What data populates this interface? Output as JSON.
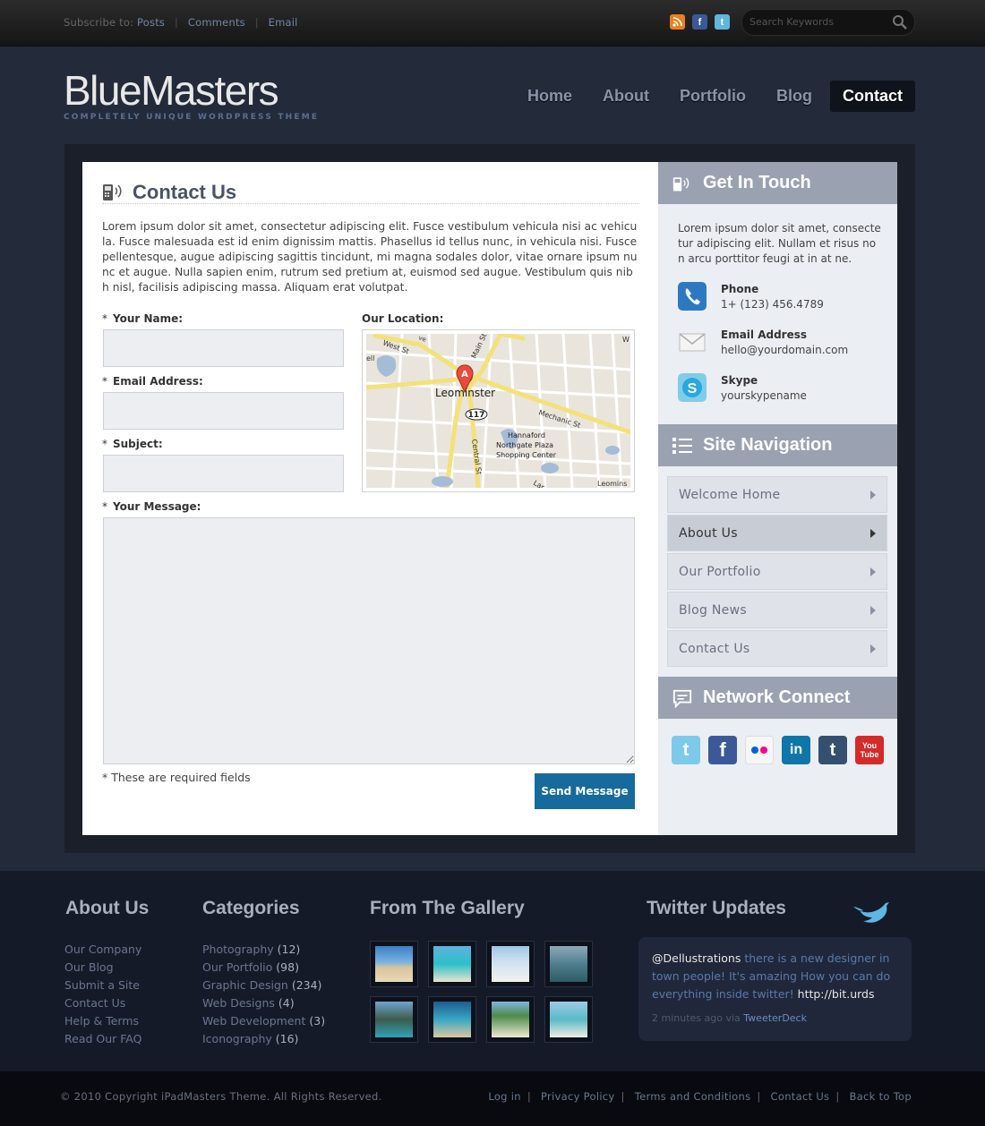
{
  "topbar": {
    "subscribe_label": "Subscribe to:",
    "links": [
      "Posts",
      "Comments",
      "Email"
    ],
    "search_placeholder": "Search Keywords"
  },
  "header": {
    "logo": "BlueMasters",
    "tagline": "COMPLETELY UNIQUE WORDPRESS THEME",
    "nav": [
      "Home",
      "About",
      "Portfolio",
      "Blog",
      "Contact"
    ],
    "active_nav": "Contact"
  },
  "contact": {
    "title": "Contact Us",
    "intro": "Lorem ipsum dolor sit amet, consectetur adipiscing elit. Fusce vestibulum vehicula nisi ac vehicula. Fusce malesuada est id enim dignissim mattis. Phasellus id tellus nunc, in vehicula nisi. Fusce pellentesque, augue adipiscing sagittis tincidunt, mi magna sodales dolor, vitae ornare ipsum nunc et augue. Nulla sapien enim, rutrum sed pretium at, euismod sed augue. Vestibulum quis nibh nisl, facilisis adipiscing massa. Aliquam erat volutpat.",
    "name_label": "Your Name:",
    "email_label": "Email Address:",
    "subject_label": "Subject:",
    "message_label": "Your Message:",
    "location_label": "Our Location:",
    "required_note": "* These are required fields",
    "send_label": "Send Message",
    "map": {
      "place": "Leominster",
      "streets": [
        "West St",
        "Main St",
        "Mechanic St",
        "Central St"
      ],
      "poi": [
        "Hannaford",
        "Northgate Plaza",
        "Shopping Center"
      ],
      "route": "117",
      "marker": "A",
      "corner_label": "Leomins",
      "edge_labels": [
        "ve",
        "ell",
        "W",
        "Lar"
      ]
    }
  },
  "sidebar": {
    "get_in_touch": {
      "title": "Get In Touch",
      "text": "Lorem ipsum dolor sit amet, consectetur adipiscing elit. Nullam et risus non arcu porttitor feugi at in at ne.",
      "items": [
        {
          "label": "Phone",
          "value": "1+ (123) 456.4789",
          "icon": "phone-icon"
        },
        {
          "label": "Email Address",
          "value": "hello@yourdomain.com",
          "icon": "mail-icon"
        },
        {
          "label": "Skype",
          "value": "yourskypename",
          "icon": "skype-icon"
        }
      ]
    },
    "site_navigation": {
      "title": "Site Navigation",
      "items": [
        "Welcome Home",
        "About Us",
        "Our Portfolio",
        "Blog News",
        "Contact Us"
      ],
      "active": "About Us"
    },
    "network_connect": {
      "title": "Network Connect",
      "icons": [
        "twitter-icon",
        "facebook-icon",
        "flickr-icon",
        "linkedin-icon",
        "tumblr-icon",
        "youtube-icon"
      ]
    }
  },
  "footer": {
    "about": {
      "title": "About Us",
      "links": [
        "Our Company",
        "Our Blog",
        "Submit a Site",
        "Contact Us",
        "Help & Terms",
        "Read Our FAQ"
      ]
    },
    "categories": {
      "title": "Categories",
      "items": [
        {
          "name": "Photography",
          "count": "(12)"
        },
        {
          "name": "Our Portfolio",
          "count": "(98)"
        },
        {
          "name": "Graphic Design",
          "count": "(234)"
        },
        {
          "name": "Web Designs",
          "count": "(4)"
        },
        {
          "name": "Web Development",
          "count": "(3)"
        },
        {
          "name": "Iconography",
          "count": "(16)"
        }
      ]
    },
    "gallery": {
      "title": "From The Gallery"
    },
    "twitter": {
      "title": "Twitter Updates",
      "user": "@Dellustrations",
      "text": " there is a new designer in town people! It's amazing How you can do everything inside twitter! ",
      "link": "http://bit.urds",
      "time": "2 minutes ago via ",
      "client": "TweeterDeck"
    }
  },
  "bottom": {
    "copyright": "© 2010 Copyright iPadMasters Theme. All Rights Reserved.",
    "links": [
      "Log in",
      "Privacy Policy",
      "Terms and Conditions",
      "Contact Us",
      "Back to Top"
    ]
  },
  "colors": {
    "accent": "#166a9c",
    "sidebar_head": "#9aa2b2",
    "footer_bg": "#151a28"
  }
}
